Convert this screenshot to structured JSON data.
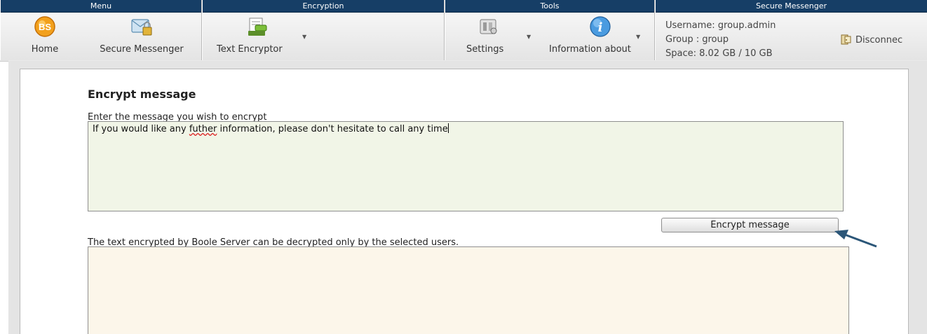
{
  "ribbon": {
    "groups": [
      {
        "header": "Menu"
      },
      {
        "header": "Encryption"
      },
      {
        "header": "Tools"
      },
      {
        "header": "Secure Messenger"
      }
    ],
    "buttons": {
      "home": "Home",
      "secure_messenger": "Secure Messenger",
      "text_encryptor": "Text Encryptor",
      "settings": "Settings",
      "information_about": "Information about"
    },
    "user_info": {
      "username": "Username: group.admin",
      "group": "Group : group",
      "space": "Space: 8.02 GB / 10 GB",
      "disconnect": "Disconnec"
    }
  },
  "main": {
    "title": "Encrypt message",
    "input_label": "Enter the message you wish to encrypt",
    "message_before": "If you would like any ",
    "message_misspelled": "futher",
    "message_after": " information, please don't hesitate to call any time",
    "encrypt_button": "Encrypt message",
    "output_label": "The text encrypted by Boole Server can be decrypted only by the selected users.",
    "output_text": ""
  },
  "colors": {
    "header_bg": "#163e66",
    "input_bg": "#f1f5e7",
    "output_bg": "#fcf6ea",
    "arrow": "#2b5678"
  },
  "icons": [
    "home-logo-icon",
    "secure-messenger-icon",
    "text-encryptor-icon",
    "settings-icon",
    "information-icon",
    "disconnect-icon",
    "dropdown-arrow-icon"
  ]
}
